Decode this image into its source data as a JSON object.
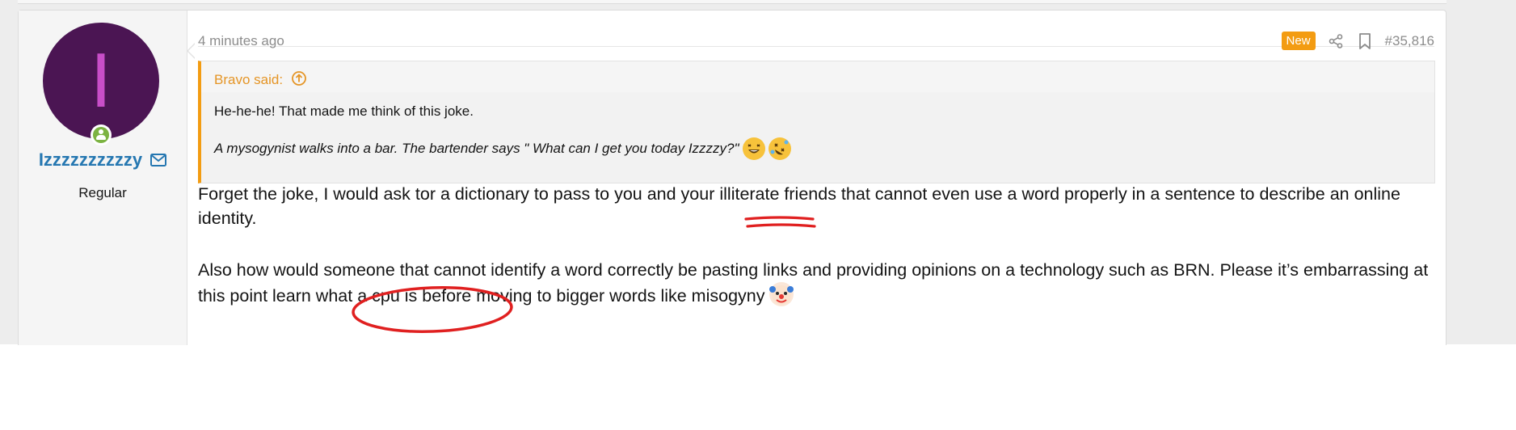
{
  "post": {
    "timestamp": "4 minutes ago",
    "badge": "New",
    "post_number": "#35,816",
    "share_icon": "share-icon",
    "bookmark_icon": "bookmark-icon"
  },
  "user": {
    "avatar_letter": "I",
    "name": "Izzzzzzzzzzy",
    "title": "Regular",
    "avatar_color": "#4b1553",
    "status_icon": "online-user-icon",
    "message_icon": "envelope-icon"
  },
  "quote": {
    "author_line": "Bravo said:",
    "expand_icon": "arrow-up-circle-icon",
    "line1": "He-he-he! That made me think of this joke.",
    "line2": "A mysogynist walks into a bar. The bartender says \" What can I get you today Izzzzy?\"",
    "emojis": [
      "grinning-squinting-face-emoji",
      "rolling-on-floor-laughing-emoji"
    ]
  },
  "body": {
    "p1_before": "Forget the joke, I would ask tor a dictionary to pass to you and your ",
    "p1_highlight": "illiterate",
    "p1_after": " friends that cannot even use a word properly in a sentence to describe an online identity.",
    "p2_text": "Also how would someone that cannot identify a word correctly be pasting links and providing opinions on a technology such as BRN. Please it’s embarrassing at this point learn what a cpu is before moving to bigger words like misogyny",
    "p2_emoji": "clown-face-emoji"
  },
  "colors": {
    "accent": "#f39c12",
    "link": "#2577b1",
    "annotation": "#e02020"
  }
}
